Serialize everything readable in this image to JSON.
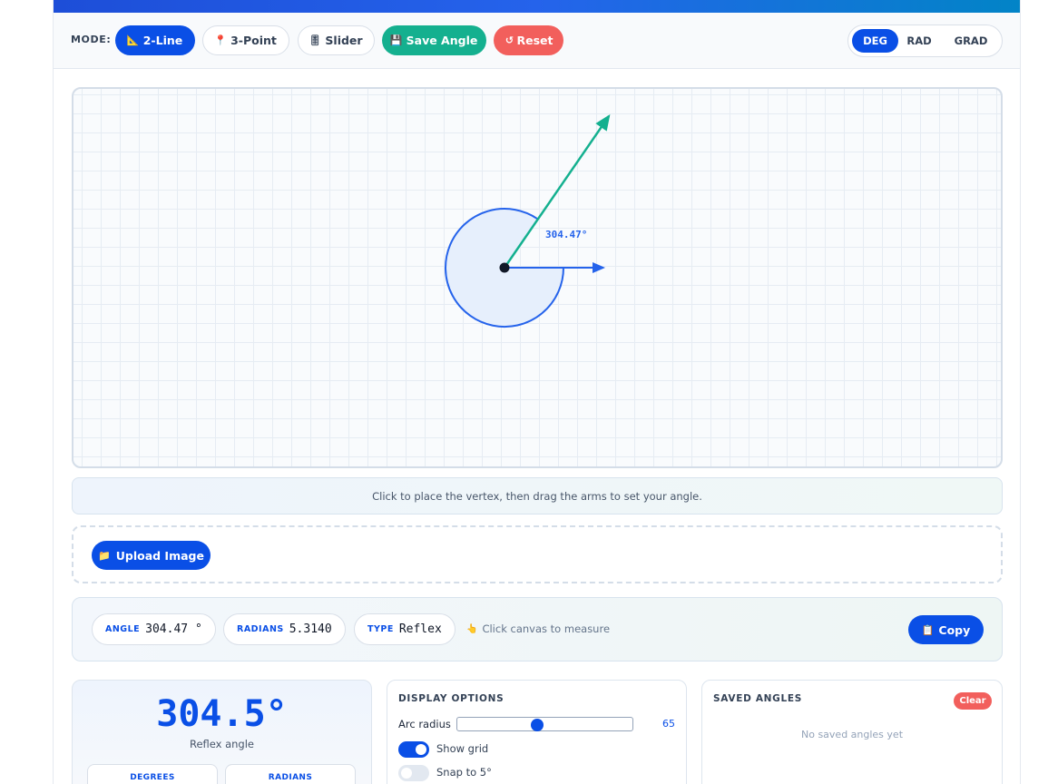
{
  "toolbar": {
    "mode_label": "MODE:",
    "modes": [
      {
        "label": "2-Line",
        "icon": "📐"
      },
      {
        "label": "3-Point",
        "icon": "📍"
      },
      {
        "label": "Slider",
        "icon": "🎚"
      }
    ],
    "save_label": "Save Angle",
    "save_icon": "💾",
    "reset_label": "Reset",
    "reset_icon": "↺",
    "units": [
      "DEG",
      "RAD",
      "GRAD"
    ],
    "active_unit": "DEG",
    "active_mode": "2-Line"
  },
  "canvas": {
    "angle_label": "304.47°",
    "arc_fill": "#e6effc",
    "arc_stroke": "#2563eb",
    "arm1_color": "#14b08f",
    "arm2_color": "#2563eb"
  },
  "hint": "Click to place the vertex, then drag the arms to set your angle.",
  "upload": {
    "label": "Upload Image",
    "icon": "📁"
  },
  "readout": {
    "angle_key": "ANGLE",
    "angle_value": "304.47 °",
    "radians_key": "RADIANS",
    "radians_value": "5.3140",
    "type_key": "TYPE",
    "type_value": "Reflex",
    "measure_hint": "Click canvas to measure",
    "measure_icon": "👆",
    "copy_label": "Copy",
    "copy_icon": "📋"
  },
  "summary": {
    "big_value": "304.5°",
    "subtitle": "Reflex angle",
    "degrees_label": "DEGREES",
    "radians_label": "RADIANS"
  },
  "display_options": {
    "title": "DISPLAY OPTIONS",
    "arc_radius_label": "Arc radius",
    "arc_radius_value": "65",
    "arc_radius_fraction": 0.45,
    "show_grid_label": "Show grid",
    "show_grid": true,
    "snap_label": "Snap to 5°",
    "snap": false
  },
  "saved": {
    "title": "SAVED ANGLES",
    "clear_label": "Clear",
    "empty_message": "No saved angles yet"
  },
  "colors": {
    "primary": "#0a4fe6",
    "green": "#14b08f",
    "red": "#f25f5c"
  }
}
